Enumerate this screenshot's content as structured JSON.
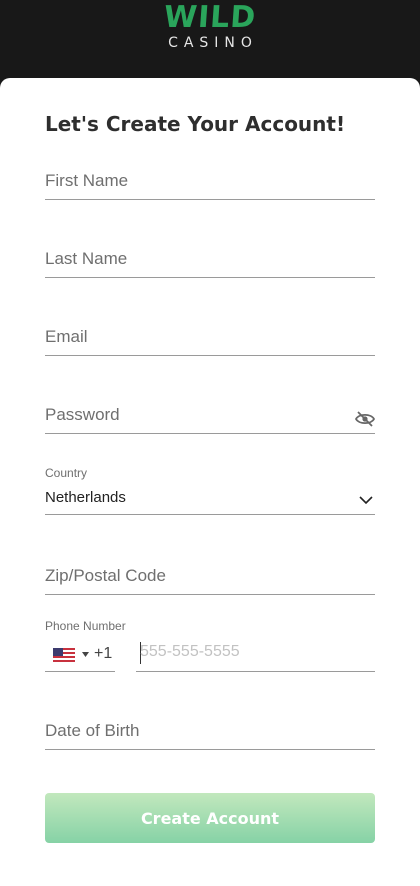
{
  "brand": {
    "logo_main": "WILD",
    "logo_sub": "CASINO",
    "logo_color": "#2aa55b"
  },
  "form": {
    "title": "Let's Create Your Account!",
    "first_name": {
      "placeholder": "First Name"
    },
    "last_name": {
      "placeholder": "Last Name"
    },
    "email": {
      "placeholder": "Email"
    },
    "password": {
      "placeholder": "Password",
      "toggle_icon": "eye-slash-icon"
    },
    "country": {
      "label": "Country",
      "value": "Netherlands",
      "icon": "chevron-down-icon"
    },
    "zip": {
      "placeholder": "Zip/Postal Code"
    },
    "phone": {
      "label": "Phone Number",
      "country_flag": "us-flag-icon",
      "dial_code": "+1",
      "placeholder": "555-555-5555"
    },
    "dob": {
      "placeholder": "Date of Birth"
    },
    "submit_label": "Create Account"
  },
  "colors": {
    "button_gradient_top": "#c2e8bd",
    "button_gradient_bottom": "#86d2a6",
    "header_bg": "#181818"
  }
}
